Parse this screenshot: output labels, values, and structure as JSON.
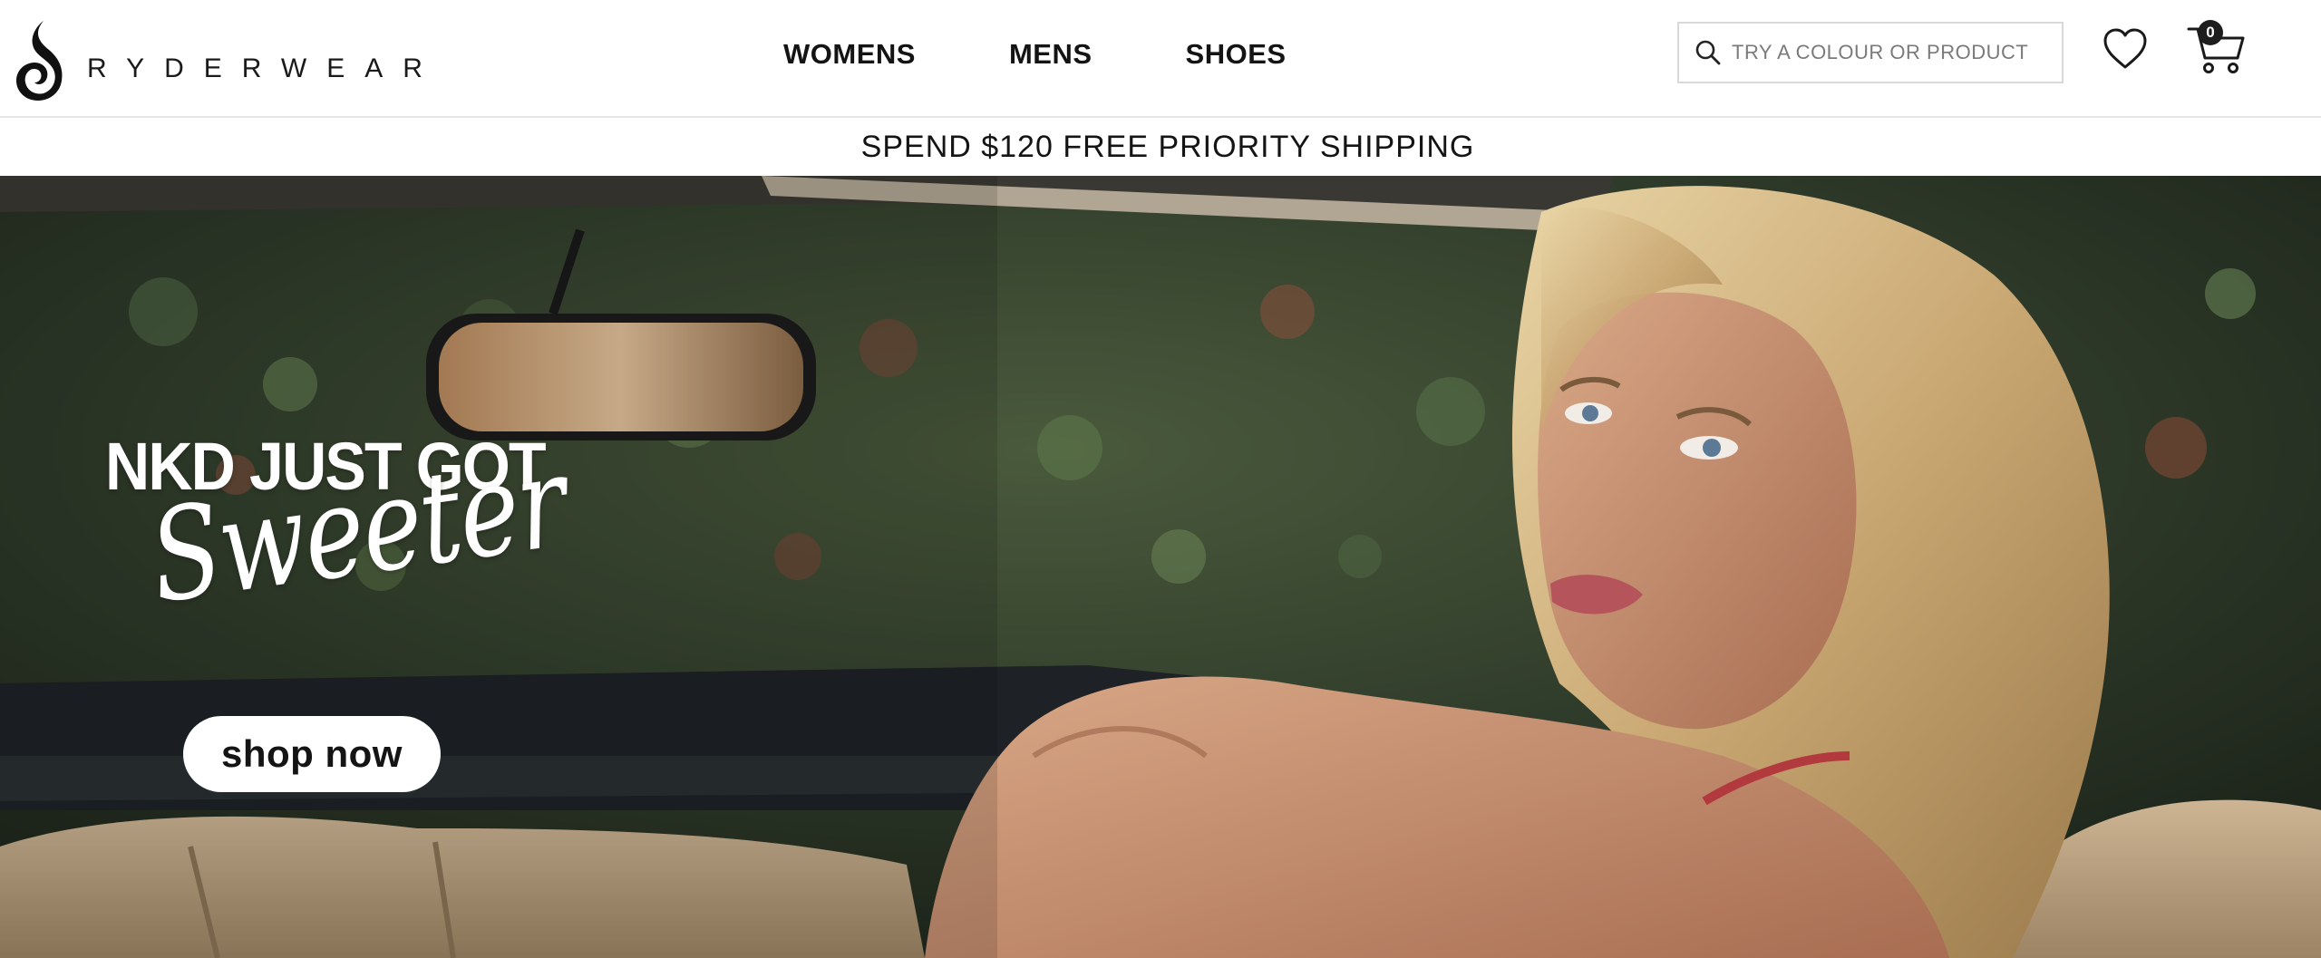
{
  "brand": {
    "name": "RYDERWEAR"
  },
  "nav": {
    "items": [
      {
        "label": "WOMENS"
      },
      {
        "label": "MENS"
      },
      {
        "label": "SHOES"
      }
    ]
  },
  "search": {
    "placeholder": "TRY A COLOUR OR PRODUCT",
    "value": ""
  },
  "cart": {
    "count": "0"
  },
  "announcement": {
    "text": "SPEND $120 FREE PRIORITY SHIPPING"
  },
  "hero": {
    "title": "NKD JUST GOT",
    "script_word": "Sweeter",
    "cta_label": "shop now"
  },
  "icons": {
    "logo": "ryderwear-flame-logo-icon",
    "search": "search-icon",
    "wishlist": "heart-icon",
    "cart": "cart-icon"
  },
  "colors": {
    "text": "#141414",
    "header_bg": "#ffffff",
    "badge_bg": "#1d1d1d",
    "cta_bg": "#ffffff"
  }
}
